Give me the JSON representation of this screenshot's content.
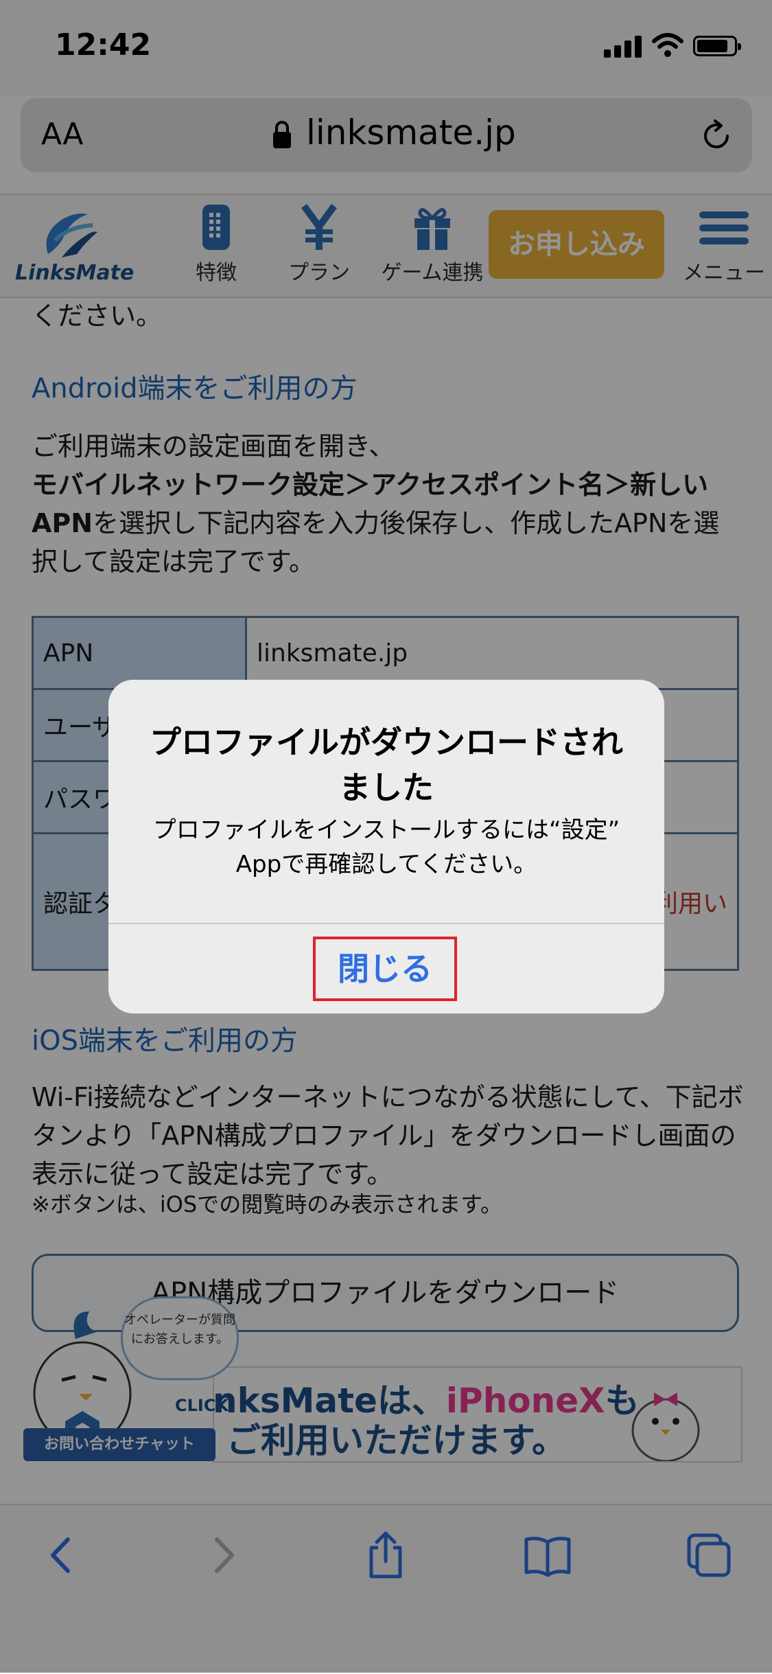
{
  "status_bar": {
    "time": "12:42"
  },
  "browser": {
    "text_size_label": "AA",
    "url": "linksmate.jp"
  },
  "site_header": {
    "logo_text": "LinksMate",
    "nav": [
      {
        "label": "特徴"
      },
      {
        "label": "プラン"
      },
      {
        "label": "ゲーム連携"
      }
    ],
    "apply_label": "お申し込み",
    "menu_label": "メニュー"
  },
  "content": {
    "truncated_line": "ください。",
    "android_heading": "Android端末をご利用の方",
    "android_intro": "ご利用端末の設定画面を開き、",
    "android_path": "モバイルネットワーク設定＞アクセスポイント名＞新しいAPN",
    "android_rest": "を選択し下記内容を入力後保存し、作成したAPNを選択して設定は完了です。",
    "table": [
      {
        "key": "APN",
        "value": "linksmate.jp"
      },
      {
        "key": "ユーザ",
        "value": ""
      },
      {
        "key": "パスワ",
        "value": ""
      },
      {
        "key": "認証タ",
        "value": "利用い"
      }
    ],
    "ios_heading": "iOS端末をご利用の方",
    "ios_text": "Wi-Fi接続などインターネットにつながる状態にして、下記ボタンより「APN構成プロファイル」をダウンロードし画面の表示に従って設定は完了です。",
    "ios_note": "※ボタンは、iOSでの閲覧時のみ表示されます。",
    "download_button": "APN構成プロファイルをダウンロード",
    "banner_line1_a": "nksMateは、",
    "banner_line1_b": "iPhoneX",
    "banner_line1_c": "も",
    "banner_line2": "ご利用いただけます。",
    "chat_bubble": "オペレーターが質問にお答えします。",
    "chat_click": "CLICK",
    "chat_label": "お問い合わせチャット"
  },
  "alert": {
    "title": "プロファイルがダウンロードされました",
    "message": "プロファイルをインストールするには“設定” Appで再確認してください。",
    "close_label": "閉じる"
  },
  "colors": {
    "accent_link": "#1e64b6",
    "apply_button": "#eab13c",
    "alert_button": "#2f6fe0",
    "highlight_border": "#e0222b"
  }
}
